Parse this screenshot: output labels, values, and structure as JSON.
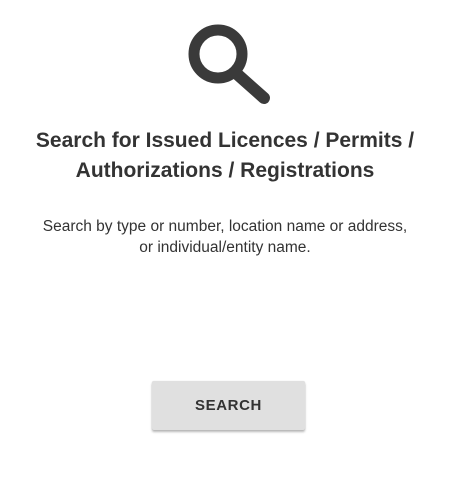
{
  "panel": {
    "icon": "search-icon",
    "title_line1": "Search for Issued Licences / Permits /",
    "title_line2": "Authorizations / Registrations",
    "description": "Search by type or number, location name or address, or individual/entity name.",
    "search_label": "SEARCH"
  },
  "colors": {
    "text": "#333333",
    "icon": "#3a3a3a",
    "button_bg": "#e0e0e0",
    "background": "#ffffff"
  }
}
